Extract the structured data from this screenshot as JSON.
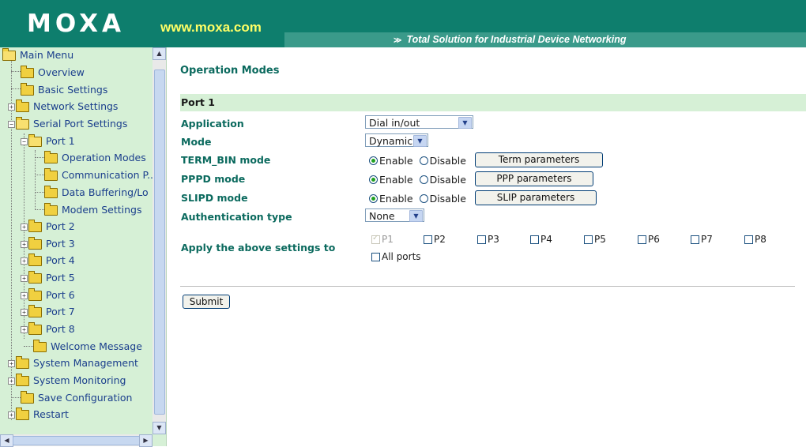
{
  "header": {
    "logo": "MOXA",
    "site": "www.moxa.com",
    "slogan_arrows": "≫",
    "slogan": "Total Solution for Industrial Device Networking"
  },
  "sidebar": {
    "items": [
      {
        "label": "Main Menu"
      },
      {
        "label": "Overview"
      },
      {
        "label": "Basic Settings"
      },
      {
        "label": "Network Settings"
      },
      {
        "label": "Serial Port Settings"
      },
      {
        "label": "Port 1"
      },
      {
        "label": "Operation Modes"
      },
      {
        "label": "Communication P..."
      },
      {
        "label": "Data Buffering/Lo"
      },
      {
        "label": "Modem Settings"
      },
      {
        "label": "Port 2"
      },
      {
        "label": "Port 3"
      },
      {
        "label": "Port 4"
      },
      {
        "label": "Port 5"
      },
      {
        "label": "Port 6"
      },
      {
        "label": "Port 7"
      },
      {
        "label": "Port 8"
      },
      {
        "label": "Welcome Message"
      },
      {
        "label": "System Management"
      },
      {
        "label": "System Monitoring"
      },
      {
        "label": "Save Configuration"
      },
      {
        "label": "Restart"
      }
    ]
  },
  "main": {
    "title": "Operation Modes",
    "port": "Port 1",
    "application": {
      "label": "Application",
      "value": "Dial in/out"
    },
    "mode": {
      "label": "Mode",
      "value": "Dynamic"
    },
    "term_bin": {
      "label": "TERM_BIN mode",
      "enable": "Enable",
      "disable": "Disable",
      "button": "Term parameters"
    },
    "pppd": {
      "label": "PPPD mode",
      "enable": "Enable",
      "disable": "Disable",
      "button": "PPP parameters"
    },
    "slipd": {
      "label": "SLIPD mode",
      "enable": "Enable",
      "disable": "Disable",
      "button": "SLIP parameters"
    },
    "auth": {
      "label": "Authentication type",
      "value": "None"
    },
    "apply": {
      "label": "Apply the above settings to",
      "ports": [
        "P1",
        "P2",
        "P3",
        "P4",
        "P5",
        "P6",
        "P7",
        "P8"
      ],
      "all_ports": "All ports"
    },
    "submit": "Submit"
  }
}
